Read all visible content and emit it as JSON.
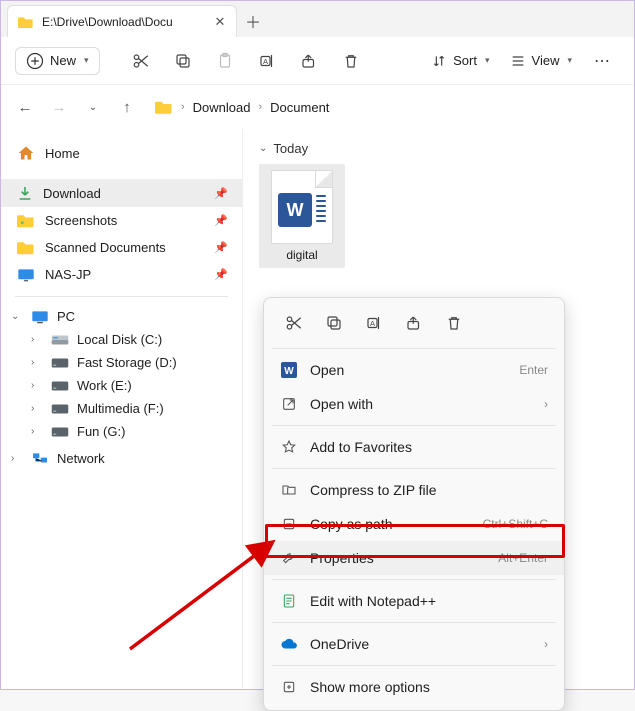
{
  "tab": {
    "title": "E:\\Drive\\Download\\Docu"
  },
  "toolbar": {
    "new_label": "New",
    "sort_label": "Sort",
    "view_label": "View"
  },
  "breadcrumb": {
    "items": [
      "Download",
      "Document"
    ]
  },
  "sidebar": {
    "home_label": "Home",
    "quick": [
      {
        "label": "Download"
      },
      {
        "label": "Screenshots"
      },
      {
        "label": "Scanned Documents"
      },
      {
        "label": "NAS-JP"
      }
    ],
    "pc_label": "PC",
    "drives": [
      {
        "label": "Local Disk (C:)"
      },
      {
        "label": "Fast Storage (D:)"
      },
      {
        "label": "Work (E:)"
      },
      {
        "label": "Multimedia (F:)"
      },
      {
        "label": "Fun (G:)"
      }
    ],
    "network_label": "Network"
  },
  "content": {
    "group_label": "Today",
    "file": {
      "name": "digital"
    }
  },
  "context_menu": {
    "open": {
      "label": "Open",
      "accel": "Enter"
    },
    "open_with": {
      "label": "Open with"
    },
    "favorites": {
      "label": "Add to Favorites"
    },
    "zip": {
      "label": "Compress to ZIP file"
    },
    "copy_path": {
      "label": "Copy as path",
      "accel": "Ctrl+Shift+C"
    },
    "properties": {
      "label": "Properties",
      "accel": "Alt+Enter"
    },
    "notepadpp": {
      "label": "Edit with Notepad++"
    },
    "onedrive": {
      "label": "OneDrive"
    },
    "more": {
      "label": "Show more options"
    }
  }
}
